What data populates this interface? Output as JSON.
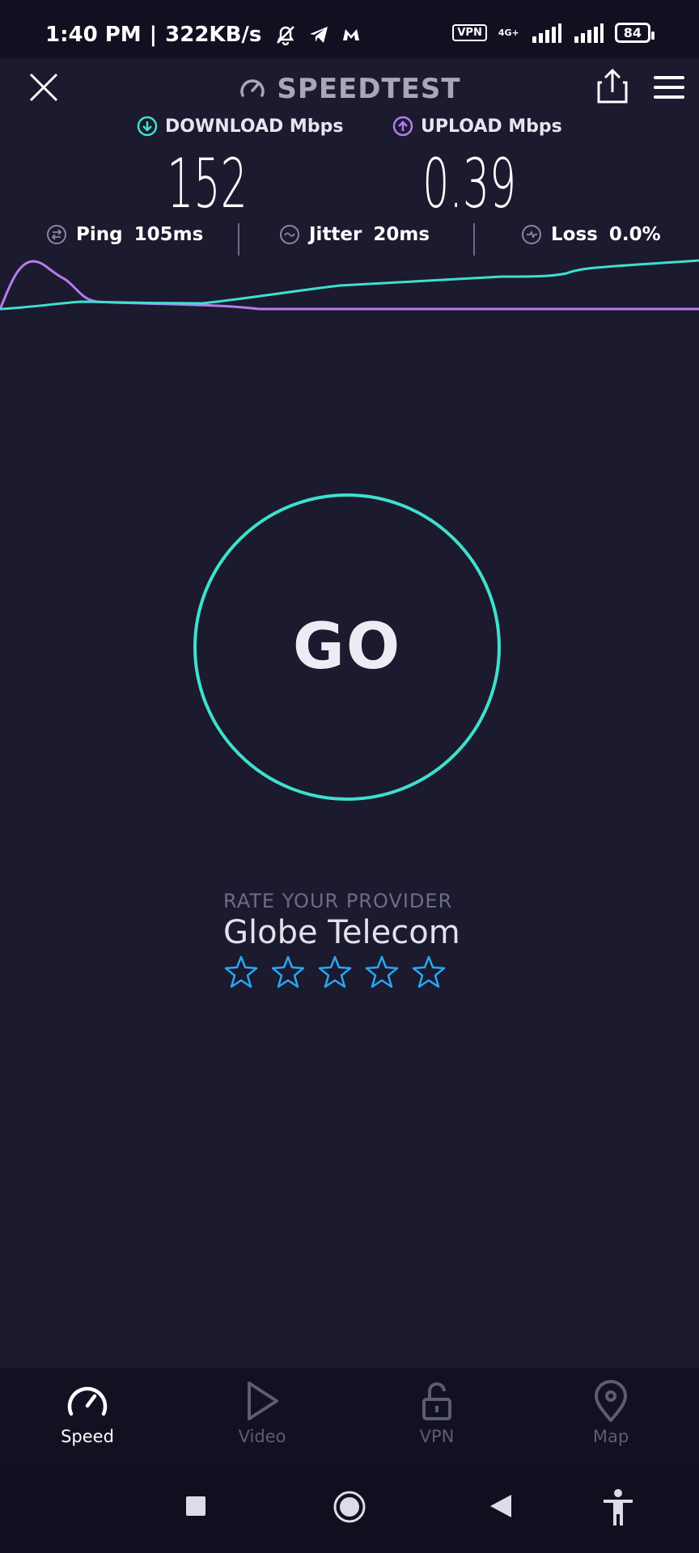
{
  "status_bar": {
    "time": "1:40 PM",
    "network_speed": "322KB/s",
    "vpn": "VPN",
    "network_type": "4G+",
    "battery": "84"
  },
  "header": {
    "title": "SPEEDTEST"
  },
  "metrics": {
    "download_label": "DOWNLOAD Mbps",
    "download_value": "152",
    "upload_label": "UPLOAD Mbps",
    "upload_value": "0.39",
    "ping_label": "Ping",
    "ping_value": "105ms",
    "jitter_label": "Jitter",
    "jitter_value": "20ms",
    "loss_label": "Loss",
    "loss_value": "0.0%"
  },
  "go_button": {
    "label": "GO"
  },
  "rating": {
    "title": "RATE YOUR PROVIDER",
    "provider": "Globe Telecom",
    "stars_filled": 0,
    "stars_total": 5
  },
  "bottom_nav": {
    "items": [
      {
        "label": "Speed",
        "icon": "speedometer-icon",
        "active": true
      },
      {
        "label": "Video",
        "icon": "play-icon",
        "active": false
      },
      {
        "label": "VPN",
        "icon": "lock-open-icon",
        "active": false
      },
      {
        "label": "Map",
        "icon": "map-pin-icon",
        "active": false
      }
    ]
  },
  "colors": {
    "background": "#1b1a2e",
    "download_accent": "#3ee0cf",
    "upload_accent": "#b57cf0",
    "star": "#2aa6f2"
  }
}
